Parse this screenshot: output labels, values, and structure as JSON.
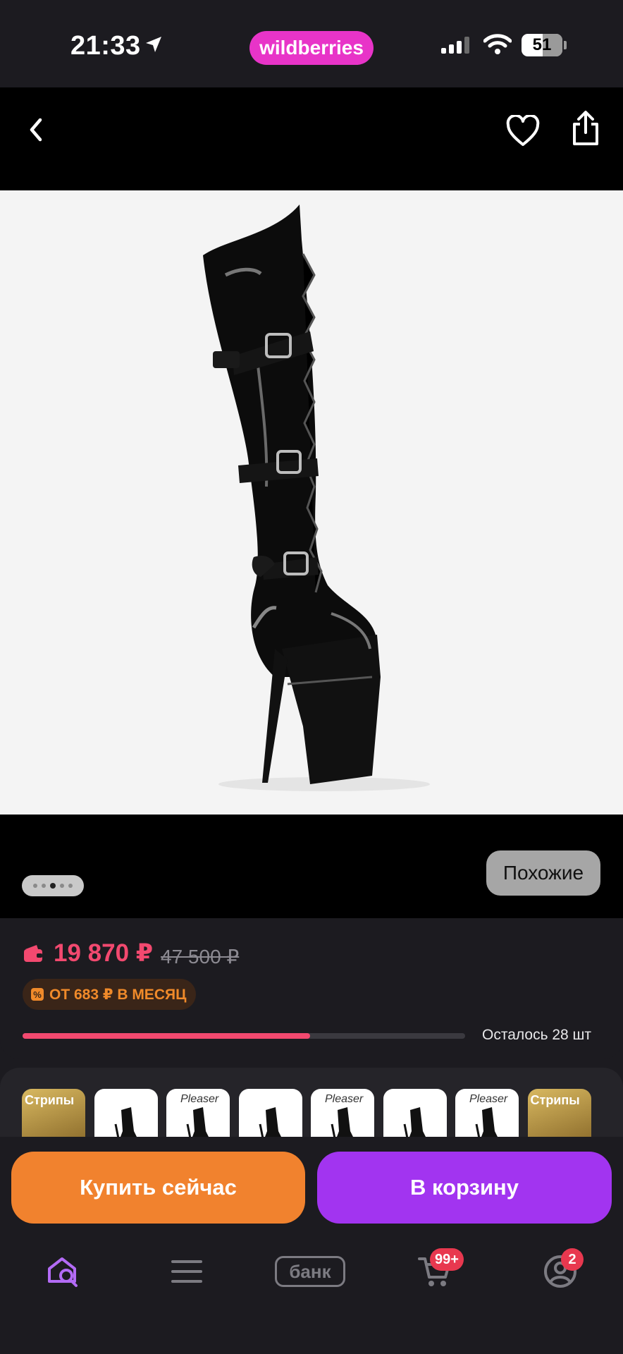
{
  "status_bar": {
    "time": "21:33",
    "brand": "wildberries",
    "battery": "51"
  },
  "top_nav": {
    "icons": [
      "back-icon",
      "heart-icon",
      "share-icon"
    ]
  },
  "gallery": {
    "image_alt": "black patent thigh-high platform boot",
    "similar_label": "Похожие",
    "dot_count": 5,
    "active_dot": 2
  },
  "price_card": {
    "price": "19 870 ₽",
    "old_price": "47 500 ₽",
    "installment": "ОТ 683 ₽ В МЕСЯЦ",
    "stock_label": "Осталось 28 шт",
    "stock_fill_fraction": 0.65
  },
  "thumbnails": {
    "items": [
      {
        "label": "Стрипы",
        "style": "gold"
      },
      {
        "label": "",
        "style": "boot"
      },
      {
        "label": "Pleaser",
        "style": "boot"
      },
      {
        "label": "",
        "style": "boot"
      },
      {
        "label": "Pleaser",
        "style": "boot"
      },
      {
        "label": "",
        "style": "boot"
      },
      {
        "label": "Pleaser",
        "style": "boot"
      },
      {
        "label": "Стрипы",
        "style": "gold"
      }
    ]
  },
  "actions": {
    "buy_now": "Купить сейчас",
    "to_cart": "В корзину"
  },
  "tab_bar": {
    "bank_label": "банк",
    "cart_badge": "99+",
    "profile_badge": "2",
    "colors": {
      "active": "#b36bf5",
      "inactive": "#7c7b82"
    }
  }
}
